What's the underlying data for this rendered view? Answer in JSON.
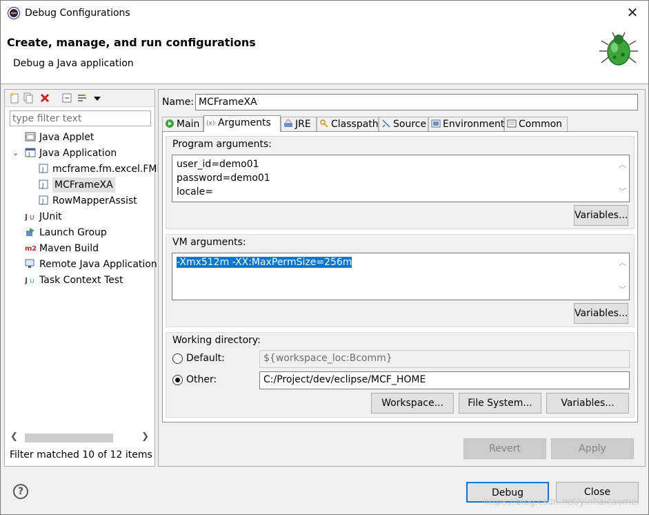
{
  "window": {
    "title": "Debug Configurations",
    "close_glyph": "✕"
  },
  "banner": {
    "heading": "Create, manage, and run configurations",
    "subheading": "Debug a Java application",
    "icon": "debug-bug-icon"
  },
  "left_panel": {
    "filter_placeholder": "type filter text",
    "tree": [
      {
        "label": "Java Applet",
        "icon": "java-applet-icon"
      },
      {
        "label": "Java Application",
        "icon": "java-application-icon",
        "expanded": true
      },
      {
        "label": "mcframe.fm.excel.FME",
        "icon": "java-class-icon"
      },
      {
        "label": "MCFrameXA",
        "icon": "java-class-icon",
        "selected": true
      },
      {
        "label": "RowMapperAssist",
        "icon": "java-class-icon"
      },
      {
        "label": "JUnit",
        "icon": "junit-icon"
      },
      {
        "label": "Launch Group",
        "icon": "launch-group-icon"
      },
      {
        "label": "Maven Build",
        "icon": "maven-icon"
      },
      {
        "label": "Remote Java Application",
        "icon": "remote-java-icon"
      },
      {
        "label": "Task Context Test",
        "icon": "task-context-icon"
      }
    ],
    "status": "Filter matched 10 of 12 items",
    "twisty_glyph": "⌄",
    "scroll_left": "❮",
    "scroll_right": "❯"
  },
  "config": {
    "name_label": "Name:",
    "name_value": "MCFrameXA",
    "tabs": [
      {
        "label": "Main",
        "icon": "main-tab-icon"
      },
      {
        "label": "Arguments",
        "icon": "arguments-tab-icon",
        "active": true
      },
      {
        "label": "JRE",
        "icon": "jre-tab-icon"
      },
      {
        "label": "Classpath",
        "icon": "classpath-tab-icon"
      },
      {
        "label": "Source",
        "icon": "source-tab-icon"
      },
      {
        "label": "Environment",
        "icon": "environment-tab-icon"
      },
      {
        "label": "Common",
        "icon": "common-tab-icon"
      }
    ],
    "program_args": {
      "label": "Program arguments:",
      "lines": [
        "user_id=demo01",
        "password=demo01",
        "locale="
      ],
      "variables_button": "Variables..."
    },
    "vm_args": {
      "label": "VM arguments:",
      "value": "-Xmx512m -XX:MaxPermSize=256m",
      "variables_button": "Variables..."
    },
    "working_dir": {
      "label": "Working directory:",
      "default_label": "Default:",
      "default_value": "${workspace_loc:Bcomm}",
      "other_label": "Other:",
      "other_value": "C:/Project/dev/eclipse/MCF_HOME",
      "selected": "other",
      "workspace_button": "Workspace...",
      "filesystem_button": "File System...",
      "variables_button": "Variables..."
    },
    "revert_button": "Revert",
    "apply_button": "Apply"
  },
  "footer": {
    "help_glyph": "?",
    "debug_button": "Debug",
    "close_button": "Close",
    "watermark": "https://blog.csdn.net/yinhaicaomei"
  },
  "colors": {
    "selection": "#0078d7",
    "default_border": "#0078d7",
    "bug_green": "#3da33d"
  }
}
